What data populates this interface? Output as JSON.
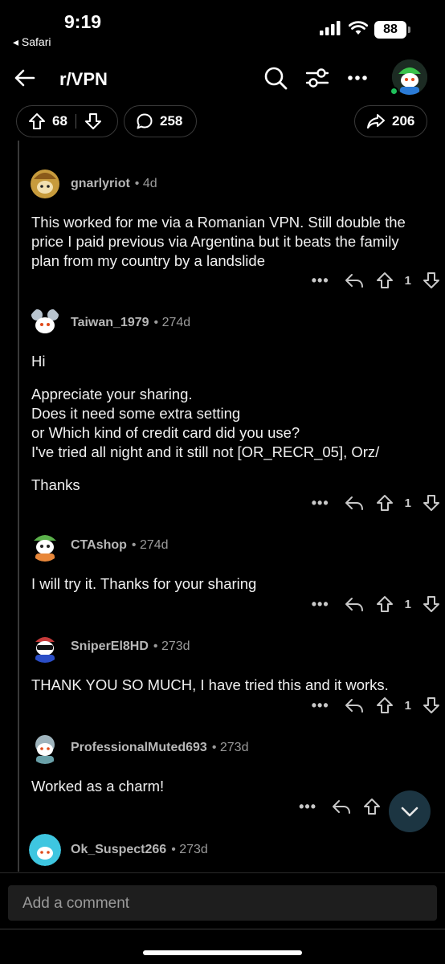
{
  "status_bar": {
    "time": "9:19",
    "back_app": "◂ Safari",
    "battery": "88"
  },
  "nav": {
    "title": "r/VPN",
    "icons": [
      "back-arrow-icon",
      "search-icon",
      "filter-icon",
      "more-icon",
      "avatar"
    ]
  },
  "post_actions": {
    "upvotes": "68",
    "comments": "258",
    "shares": "206"
  },
  "comments": [
    {
      "user": "gnarlyriot",
      "time": "• 4d",
      "avatar_color": "#c79b3c",
      "paragraphs": [
        "This worked for me via a Romanian VPN. Still double the price I paid previous via Argentina but it beats the family plan from my country by a landslide"
      ],
      "votes": "1"
    },
    {
      "user": "Taiwan_1979",
      "time": "• 274d",
      "avatar_color": "#8e9aa8",
      "paragraphs": [
        "Hi",
        "Appreciate your sharing.\nDoes it need some extra setting\nor Which kind of credit card did you use?\nI've tried all night and it still not [OR_RECR_05], Orz/",
        "Thanks"
      ],
      "votes": "1"
    },
    {
      "user": "CTAshop",
      "time": "• 274d",
      "avatar_color": "#e8873a",
      "paragraphs": [
        "I will try it. Thanks for your sharing"
      ],
      "votes": "1"
    },
    {
      "user": "SniperEl8HD",
      "time": "• 273d",
      "avatar_color": "#c73a3a",
      "paragraphs": [
        "THANK YOU SO MUCH, I have tried this and it works."
      ],
      "votes": "1"
    },
    {
      "user": "ProfessionalMuted693",
      "time": "• 273d",
      "avatar_color": "#6aa0a8",
      "paragraphs": [
        "Worked as a charm!"
      ],
      "votes": ""
    },
    {
      "user": "Ok_Suspect266",
      "time": "• 273d",
      "avatar_color": "#3ec6e0",
      "paragraphs": [],
      "votes": ""
    }
  ],
  "comment_input": {
    "placeholder": "Add a comment"
  }
}
